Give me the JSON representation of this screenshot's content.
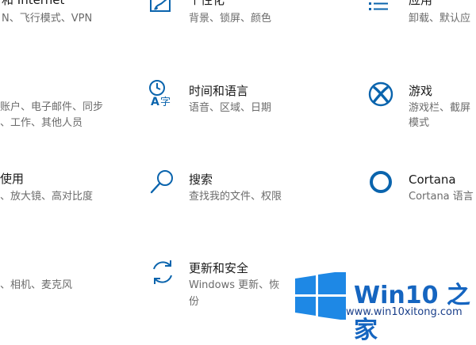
{
  "accent_color": "#0a64ad",
  "tiles": {
    "network": {
      "title": "和 Internet",
      "desc": "N、飞行模式、VPN"
    },
    "personalization": {
      "title": "个性化",
      "desc": "背景、锁屏、颜色"
    },
    "apps": {
      "title": "应用",
      "desc": "卸载、默认应"
    },
    "accounts": {
      "desc1": "账户、电子邮件、同步",
      "desc2": "、工作、其他人员"
    },
    "time_language": {
      "title": "时间和语言",
      "desc": "语音、区域、日期"
    },
    "gaming": {
      "title": "游戏",
      "desc1": "游戏栏、截屏",
      "desc2": "模式"
    },
    "ease": {
      "title": "使用",
      "desc": "、放大镜、高对比度"
    },
    "search": {
      "title": "搜索",
      "desc": "查找我的文件、权限"
    },
    "cortana": {
      "title": "Cortana",
      "desc": "Cortana 语言"
    },
    "privacy": {
      "desc": "、相机、麦克风"
    },
    "update_security": {
      "title": "更新和安全",
      "desc1": "Windows 更新、恢",
      "desc2": "份"
    }
  },
  "icons": {
    "personalization": "paint-brush-icon",
    "apps": "apps-list-icon",
    "time_language": "time-language-icon",
    "gaming": "xbox-icon",
    "search": "magnifier-icon",
    "cortana": "cortana-ring-icon",
    "update_security": "refresh-icon"
  },
  "watermark": {
    "title": "Win10 之家",
    "url": "www.win10xitong.com"
  }
}
